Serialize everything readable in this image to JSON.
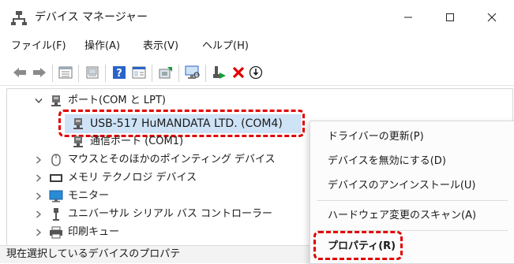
{
  "window": {
    "title": "デバイス マネージャー",
    "controls": {
      "minimize": "—",
      "maximize": "☐",
      "close": "✕"
    }
  },
  "menu": {
    "items": [
      "ファイル(F)",
      "操作(A)",
      "表示(V)",
      "ヘルプ(H)"
    ]
  },
  "toolbar": {
    "icons": [
      "back-icon",
      "forward-icon",
      "properties-view-icon",
      "device-list-icon",
      "help-icon",
      "details-icon",
      "update-driver-icon",
      "scan-hardware-icon",
      "enable-device-icon",
      "uninstall-icon",
      "download-icon"
    ]
  },
  "tree": {
    "ports_label": "ポート(COM と LPT)",
    "selected_device": "USB-517 HuMANDATA LTD. (COM4)",
    "comm_port": "通信ポート (COM1)",
    "mouse": "マウスとそのほかのポインティング デバイス",
    "memory": "メモリ テクノロジ デバイス",
    "monitor": "モニター",
    "usb_controllers": "ユニバーサル シリアル バス コントローラー",
    "print_queue": "印刷キュー"
  },
  "context_menu": {
    "update_driver": "ドライバーの更新(P)",
    "disable_device": "デバイスを無効にする(D)",
    "uninstall_device": "デバイスのアンインストール(U)",
    "scan_hardware": "ハードウェア変更のスキャン(A)",
    "properties": "プロパティ(R)"
  },
  "status": {
    "text": "現在選択しているデバイスのプロパテ"
  },
  "colors": {
    "highlight_dash": "#e00000",
    "selection": "#cfe3f7",
    "toolbar_blue": "#2a63c9",
    "uninstall_red": "#e00000",
    "enable_green": "#1a9c3c"
  }
}
